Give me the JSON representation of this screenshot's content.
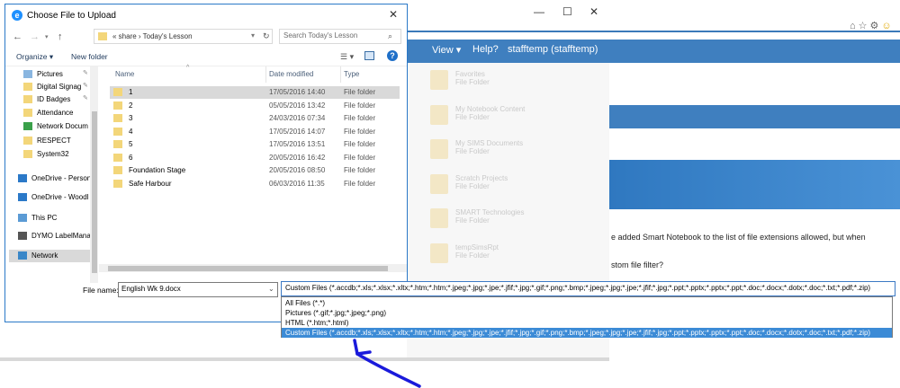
{
  "dialog": {
    "title": "Choose File to Upload",
    "address_path": "« share › Today's Lesson",
    "search_placeholder": "Search Today's Lesson",
    "toolbar": {
      "organize": "Organize ▾",
      "new_folder": "New folder"
    },
    "nav_items": [
      {
        "label": "Pictures",
        "pinned": true,
        "level": "sub"
      },
      {
        "label": "Digital Signag",
        "pinned": true,
        "level": "sub"
      },
      {
        "label": "ID Badges",
        "pinned": true,
        "level": "sub"
      },
      {
        "label": "Attendance",
        "pinned": false,
        "level": "sub"
      },
      {
        "label": "Network Docum",
        "pinned": false,
        "level": "sub"
      },
      {
        "label": "RESPECT",
        "pinned": false,
        "level": "sub"
      },
      {
        "label": "System32",
        "pinned": false,
        "level": "sub"
      },
      {
        "label": "OneDrive - Person",
        "pinned": false,
        "level": "top"
      },
      {
        "label": "OneDrive - Woodl",
        "pinned": false,
        "level": "top"
      },
      {
        "label": "This PC",
        "pinned": false,
        "level": "top"
      },
      {
        "label": "DYMO LabelMana",
        "pinned": false,
        "level": "top"
      },
      {
        "label": "Network",
        "pinned": false,
        "level": "top",
        "selected": true
      }
    ],
    "columns": {
      "name": "Name",
      "date": "Date modified",
      "type": "Type"
    },
    "files": [
      {
        "name": "1",
        "date": "17/05/2016 14:40",
        "type": "File folder",
        "selected": true
      },
      {
        "name": "2",
        "date": "05/05/2016 13:42",
        "type": "File folder"
      },
      {
        "name": "3",
        "date": "24/03/2016 07:34",
        "type": "File folder"
      },
      {
        "name": "4",
        "date": "17/05/2016 14:07",
        "type": "File folder"
      },
      {
        "name": "5",
        "date": "17/05/2016 13:51",
        "type": "File folder"
      },
      {
        "name": "6",
        "date": "20/05/2016 16:42",
        "type": "File folder"
      },
      {
        "name": "Foundation Stage",
        "date": "20/05/2016 08:50",
        "type": "File folder"
      },
      {
        "name": "Safe Harbour",
        "date": "06/03/2016 11:35",
        "type": "File folder"
      }
    ],
    "filename_label": "File name:",
    "filename_value": "English Wk 9.docx",
    "filter_value": "Custom Files (*.accdb;*.xls;*.xlsx;*.xltx;*.htm;*.htm;*.jpeg;*.jpg;*.jpe;*.jfif;*.jpg;*.gif;*.png;*.bmp;*.jpeg;*.jpg;*.jpe;*.jfif;*.jpg;*.ppt;*.pptx;*.pptx;*.ppt;*.doc;*.docx;*.dotx;*.doc;*.txt;*.pdf;*.zip)",
    "filter_options": [
      "All Files (*.*)",
      "Pictures (*.gif;*.jpg;*.jpeg;*.png)",
      "HTML (*.htm;*.html)",
      "Custom Files (*.accdb;*.xls;*.xlsx;*.xltx;*.htm;*.htm;*.jpeg;*.jpg;*.jpe;*.jfif;*.jpg;*.gif;*.png;*.bmp;*.jpeg;*.jpg;*.jpe;*.jfif;*.jpg;*.ppt;*.pptx;*.pptx;*.ppt;*.doc;*.docx;*.dotx;*.doc;*.txt;*.pdf;*.zip)"
    ],
    "selected_filter_index": 3
  },
  "browser": {
    "nav": {
      "view": "View ▾",
      "help": "Help?",
      "user": "stafftemp (stafftemp)"
    },
    "folders": [
      {
        "name": "Favorites",
        "type": "File Folder"
      },
      {
        "name": "My Notebook Content",
        "type": "File Folder"
      },
      {
        "name": "My SIMS Documents",
        "type": "File Folder"
      },
      {
        "name": "Scratch Projects",
        "type": "File Folder"
      },
      {
        "name": "SMART Technologies",
        "type": "File Folder"
      },
      {
        "name": "tempSimsRpt",
        "type": "File Folder"
      }
    ],
    "text_line1": "e added Smart Notebook to the list of file extensions allowed, but when",
    "text_line2": "stom file filter?"
  },
  "colors": {
    "accent": "#3f7fbf",
    "selection": "#3c8bd6",
    "arrow": "#1a1adb"
  }
}
